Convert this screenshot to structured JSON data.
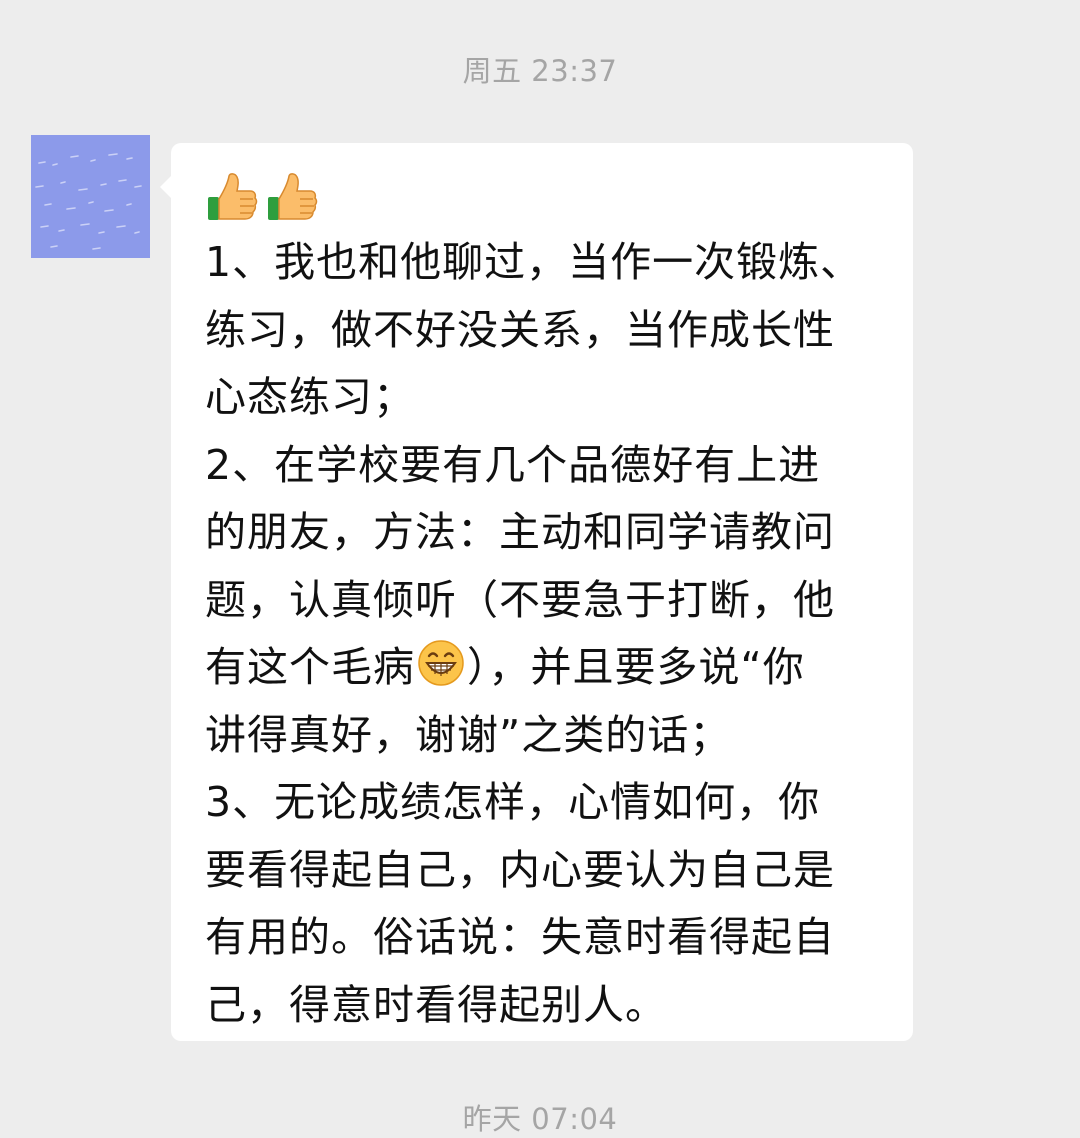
{
  "chat": {
    "timestamp_top": "周五 23:37",
    "timestamp_bottom": "昨天 07:04",
    "message": {
      "sender_avatar": "avatar-image",
      "emojis": [
        "thumbs-up-icon",
        "thumbs-up-icon"
      ],
      "lines": [
        "1、我也和他聊过，当作一次锻炼、",
        "练习，做不好没关系，当作成长性",
        "心态练习；",
        "2、在学校要有几个品德好有上进",
        "的朋友，方法：主动和同学请教问",
        "题，认真倾听（不要急于打断，他",
        {
          "before": "有这个毛病",
          "emoji": "grin-icon",
          "after": "），并且要多说“你"
        },
        "讲得真好，谢谢”之类的话；",
        "3、无论成绩怎样，心情如何，你",
        "要看得起自己，内心要认为自己是",
        "有用的。俗话说：失意时看得起自",
        "己，得意时看得起别人。"
      ]
    }
  },
  "colors": {
    "background": "#ededed",
    "bubble": "#ffffff",
    "timestamp_text": "#a5a5a5",
    "message_text": "#111111",
    "avatar": "#8c9aea"
  }
}
